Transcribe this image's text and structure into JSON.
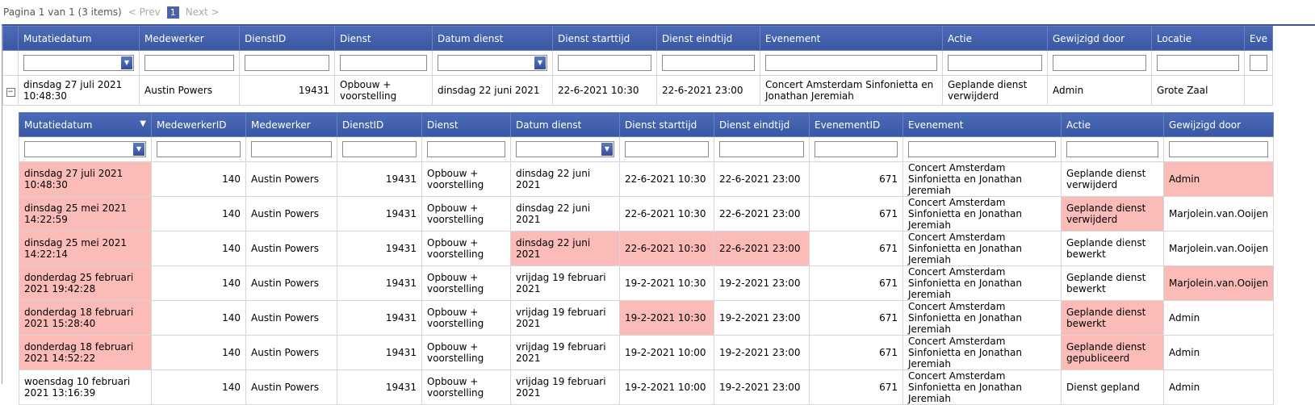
{
  "pager": {
    "info": "Pagina 1 van 1 (3 items)",
    "prev": "< Prev",
    "page": "1",
    "next": "Next >"
  },
  "outer": {
    "columns": [
      "Mutatiedatum",
      "Medewerker",
      "DienstID",
      "Dienst",
      "Datum dienst",
      "Dienst starttijd",
      "Dienst eindtijd",
      "Evenement",
      "Actie",
      "Gewijzigd door",
      "Locatie",
      "Eve"
    ],
    "row": {
      "mutatiedatum": "dinsdag 27 juli 2021 10:48:30",
      "medewerker": "Austin Powers",
      "dienstid": "19431",
      "dienst": "Opbouw + voorstelling",
      "datum_dienst": "dinsdag 22 juni 2021",
      "starttijd": "22-6-2021 10:30",
      "eindtijd": "22-6-2021 23:00",
      "evenement": "Concert Amsterdam Sinfonietta en Jonathan Jeremiah",
      "actie": "Geplande dienst verwijderd",
      "gewijzigd_door": "Admin",
      "locatie": "Grote Zaal"
    },
    "expand_icon": "minus-icon"
  },
  "inner": {
    "columns": [
      "Mutatiedatum",
      "MedewerkerID",
      "Medewerker",
      "DienstID",
      "Dienst",
      "Datum dienst",
      "Dienst starttijd",
      "Dienst eindtijd",
      "EvenementID",
      "Evenement",
      "Actie",
      "Gewijzigd door"
    ],
    "sort_icon": "sort-desc-icon",
    "rows": [
      {
        "mutatiedatum": "dinsdag 27 juli 2021 10:48:30",
        "medewerkerid": "140",
        "medewerker": "Austin Powers",
        "dienstid": "19431",
        "dienst": "Opbouw + voorstelling",
        "datum_dienst": "dinsdag 22 juni 2021",
        "starttijd": "22-6-2021 10:30",
        "eindtijd": "22-6-2021 23:00",
        "evenementid": "671",
        "evenement": "Concert Amsterdam Sinfonietta en Jonathan Jeremiah",
        "actie": "Geplande dienst verwijderd",
        "gewijzigd_door": "Admin"
      },
      {
        "mutatiedatum": "dinsdag 25 mei 2021 14:22:59",
        "medewerkerid": "140",
        "medewerker": "Austin Powers",
        "dienstid": "19431",
        "dienst": "Opbouw + voorstelling",
        "datum_dienst": "dinsdag 22 juni 2021",
        "starttijd": "22-6-2021 10:30",
        "eindtijd": "22-6-2021 23:00",
        "evenementid": "671",
        "evenement": "Concert Amsterdam Sinfonietta en Jonathan Jeremiah",
        "actie": "Geplande dienst verwijderd",
        "gewijzigd_door": "Marjolein.van.Ooijen"
      },
      {
        "mutatiedatum": "dinsdag 25 mei 2021 14:22:14",
        "medewerkerid": "140",
        "medewerker": "Austin Powers",
        "dienstid": "19431",
        "dienst": "Opbouw + voorstelling",
        "datum_dienst": "dinsdag 22 juni 2021",
        "starttijd": "22-6-2021 10:30",
        "eindtijd": "22-6-2021 23:00",
        "evenementid": "671",
        "evenement": "Concert Amsterdam Sinfonietta en Jonathan Jeremiah",
        "actie": "Geplande dienst bewerkt",
        "gewijzigd_door": "Marjolein.van.Ooijen"
      },
      {
        "mutatiedatum": "donderdag 25 februari 2021 19:42:28",
        "medewerkerid": "140",
        "medewerker": "Austin Powers",
        "dienstid": "19431",
        "dienst": "Opbouw + voorstelling",
        "datum_dienst": "vrijdag 19 februari 2021",
        "starttijd": "19-2-2021 10:30",
        "eindtijd": "19-2-2021 23:00",
        "evenementid": "671",
        "evenement": "Concert Amsterdam Sinfonietta en Jonathan Jeremiah",
        "actie": "Geplande dienst bewerkt",
        "gewijzigd_door": "Marjolein.van.Ooijen"
      },
      {
        "mutatiedatum": "donderdag 18 februari 2021 15:28:40",
        "medewerkerid": "140",
        "medewerker": "Austin Powers",
        "dienstid": "19431",
        "dienst": "Opbouw + voorstelling",
        "datum_dienst": "vrijdag 19 februari 2021",
        "starttijd": "19-2-2021 10:30",
        "eindtijd": "19-2-2021 23:00",
        "evenementid": "671",
        "evenement": "Concert Amsterdam Sinfonietta en Jonathan Jeremiah",
        "actie": "Geplande dienst bewerkt",
        "gewijzigd_door": "Admin"
      },
      {
        "mutatiedatum": "donderdag 18 februari 2021 14:52:22",
        "medewerkerid": "140",
        "medewerker": "Austin Powers",
        "dienstid": "19431",
        "dienst": "Opbouw + voorstelling",
        "datum_dienst": "vrijdag 19 februari 2021",
        "starttijd": "19-2-2021 10:00",
        "eindtijd": "19-2-2021 23:00",
        "evenementid": "671",
        "evenement": "Concert Amsterdam Sinfonietta en Jonathan Jeremiah",
        "actie": "Geplande dienst gepubliceerd",
        "gewijzigd_door": "Admin"
      },
      {
        "mutatiedatum": "woensdag 10 februari 2021 13:16:39",
        "medewerkerid": "140",
        "medewerker": "Austin Powers",
        "dienstid": "19431",
        "dienst": "Opbouw + voorstelling",
        "datum_dienst": "vrijdag 19 februari 2021",
        "starttijd": "19-2-2021 10:00",
        "eindtijd": "19-2-2021 23:00",
        "evenementid": "671",
        "evenement": "Concert Amsterdam Sinfonietta en Jonathan Jeremiah",
        "actie": "Dienst gepland",
        "gewijzigd_door": "Admin"
      }
    ]
  },
  "colors": {
    "header": "#3f5ba8",
    "highlight": "#fbbcb8"
  }
}
